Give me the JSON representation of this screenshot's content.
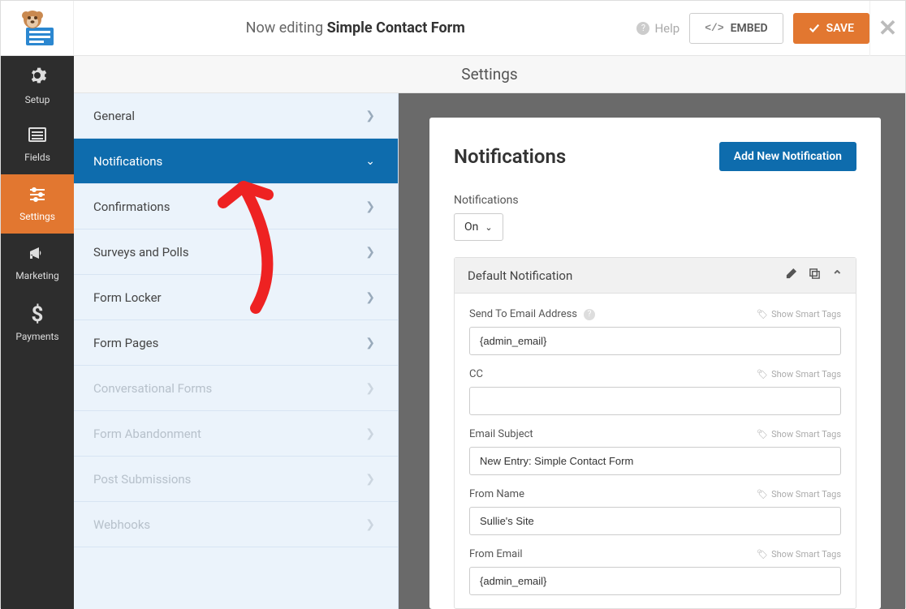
{
  "header": {
    "editing_prefix": "Now editing ",
    "form_name": "Simple Contact Form",
    "help_label": "Help",
    "embed_label": "EMBED",
    "save_label": "SAVE"
  },
  "sub_header": {
    "title": "Settings"
  },
  "nav": {
    "items": [
      {
        "label": "Setup"
      },
      {
        "label": "Fields"
      },
      {
        "label": "Settings"
      },
      {
        "label": "Marketing"
      },
      {
        "label": "Payments"
      }
    ]
  },
  "settings_list": {
    "items": [
      {
        "label": "General"
      },
      {
        "label": "Notifications"
      },
      {
        "label": "Confirmations"
      },
      {
        "label": "Surveys and Polls"
      },
      {
        "label": "Form Locker"
      },
      {
        "label": "Form Pages"
      },
      {
        "label": "Conversational Forms"
      },
      {
        "label": "Form Abandonment"
      },
      {
        "label": "Post Submissions"
      },
      {
        "label": "Webhooks"
      }
    ]
  },
  "panel": {
    "title": "Notifications",
    "add_button": "Add New Notification",
    "toggle_label": "Notifications",
    "toggle_value": "On",
    "card_title": "Default Notification",
    "smart_tags_label": "Show Smart Tags",
    "fields": {
      "send_to": {
        "label": "Send To Email Address",
        "value": "{admin_email}"
      },
      "cc": {
        "label": "CC",
        "value": ""
      },
      "subject": {
        "label": "Email Subject",
        "value": "New Entry: Simple Contact Form"
      },
      "from_name": {
        "label": "From Name",
        "value": "Sullie's Site"
      },
      "from_email": {
        "label": "From Email",
        "value": "{admin_email}"
      }
    }
  }
}
